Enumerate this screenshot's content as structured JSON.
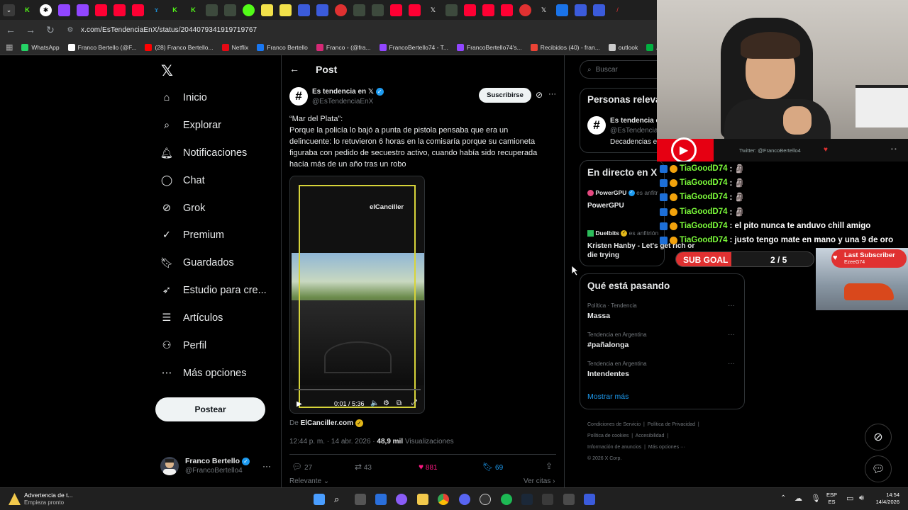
{
  "browser": {
    "url": "x.com/EsTendenciaEnX/status/2044079341919719767",
    "bookmarks": [
      {
        "label": "WhatsApp",
        "color": "#25d366"
      },
      {
        "label": "Franco Bertello (@F...",
        "color": "#ffffff"
      },
      {
        "label": "(28) Franco Bertello...",
        "color": "#ff0000"
      },
      {
        "label": "Netflix",
        "color": "#e50914"
      },
      {
        "label": "Franco Bertello",
        "color": "#1877f2"
      },
      {
        "label": "Franco  ◦ (@fra...",
        "color": "#d62976"
      },
      {
        "label": "FrancoBertello74 - T...",
        "color": "#9146ff"
      },
      {
        "label": "FrancoBertello74's...",
        "color": "#9146ff"
      },
      {
        "label": "Recibidos (40) - fran...",
        "color": "#ea4335"
      },
      {
        "label": "outlook",
        "color": "#cccccc"
      },
      {
        "label": "Aler",
        "color": "#00b140"
      }
    ]
  },
  "nav": {
    "items": [
      {
        "label": "Inicio",
        "icon": "home-icon"
      },
      {
        "label": "Explorar",
        "icon": "search-icon"
      },
      {
        "label": "Notificaciones",
        "icon": "bell-icon"
      },
      {
        "label": "Chat",
        "icon": "chat-icon"
      },
      {
        "label": "Grok",
        "icon": "grok-icon"
      },
      {
        "label": "Premium",
        "icon": "premium-icon"
      },
      {
        "label": "Guardados",
        "icon": "bookmark-icon"
      },
      {
        "label": "Estudio para cre...",
        "icon": "rocket-icon"
      },
      {
        "label": "Artículos",
        "icon": "article-icon"
      },
      {
        "label": "Perfil",
        "icon": "person-icon"
      },
      {
        "label": "Más opciones",
        "icon": "more-circle-icon"
      }
    ],
    "post_button": "Postear",
    "profile": {
      "name": "Franco Bertello",
      "handle": "@FrancoBertello4"
    }
  },
  "post": {
    "header": "Post",
    "author": {
      "name": "Es tendencia en 𝕏",
      "handle": "@EsTendenciaEnX"
    },
    "subscribe": "Suscribirse",
    "text_lines": [
      "“Mar del Plata”:",
      "Porque la policía lo bajó a punta de pistola pensaba que era un",
      "delincuente: lo retuvieron 6 horas en la comisaría porque su camioneta",
      "figuraba con pedido de secuestro activo, cuando había sido recuperada",
      "hacía más de un año tras un robo"
    ],
    "video": {
      "watermark": "elCanciller",
      "time": "0:01 / 5:36"
    },
    "source_prefix": "De",
    "source": "ElCanciller.com",
    "timestamp": "12:44 p. m. · 14 abr. 2026 · ",
    "views_count": "48,9 mil",
    "views_label": "Visualizaciones",
    "stats": {
      "replies": "27",
      "reposts": "43",
      "likes": "881",
      "bookmarks": "69"
    },
    "relevant": "Relevante",
    "quotes": "Ver citas"
  },
  "right": {
    "search_placeholder": "Buscar",
    "people_title": "Personas releva",
    "people": {
      "name": "Es tendencia e",
      "handle": "@EsTendencia",
      "bio": "Decadencias e"
    },
    "live_title": "En directo en X",
    "live": [
      {
        "host": "PowerGPU",
        "suffix": "es anfitr",
        "title": "PowerGPU"
      },
      {
        "host": "Duelbits",
        "suffix": "es anfitrión",
        "title": "Kristen Hanby - Let's get rich or die trying"
      }
    ],
    "happening_title": "Qué está pasando",
    "trends": [
      {
        "context": "Política · Tendencia",
        "name": "Massa"
      },
      {
        "context": "Tendencia en Argentina",
        "name": "#pañalonga"
      },
      {
        "context": "Tendencia en Argentina",
        "name": "Intendentes"
      }
    ],
    "show_more": "Mostrar más",
    "footer": [
      "Condiciones de Servicio",
      "Política de Privacidad",
      "Política de cookies",
      "Accesibilidad",
      "Información de anuncios",
      "Más opciones ···",
      "© 2026 X Corp."
    ]
  },
  "overlay": {
    "twitter_handle": "Twitter: @FrancoBertello4",
    "chat": [
      {
        "user": "TiaGoodD74",
        "msg": ": 🗿"
      },
      {
        "user": "TiaGoodD74",
        "msg": ": 🗿"
      },
      {
        "user": "TiaGoodD74",
        "msg": ": 🗿"
      },
      {
        "user": "TiaGoodD74",
        "msg": ": 🗿"
      },
      {
        "user": "TiaGoodD74",
        "msg": ": el pito nunca te anduvo chill amigo"
      },
      {
        "user": "TiaGoodD74",
        "msg": ": justo tengo mate en mano y una 9 de oro"
      }
    ],
    "sub_goal_label": "SUB GOAL",
    "sub_goal_value": "2 / 5",
    "last_sub_title": "Last Subscriber",
    "last_sub_name": "EzeeG74"
  },
  "taskbar": {
    "notice_title": "Advertencia de t...",
    "notice_sub": "Empieza pronto",
    "lang_top": "ESP",
    "lang_bottom": "ES",
    "time": "14:54",
    "date": "14/4/2026"
  }
}
